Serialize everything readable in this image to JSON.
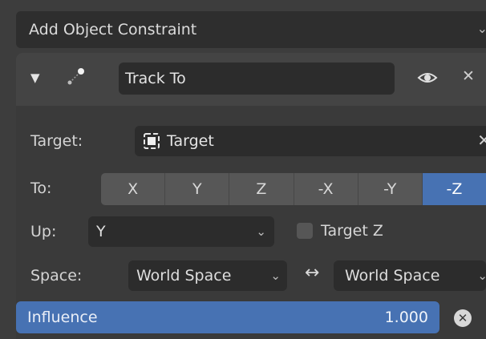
{
  "add_constraint": {
    "label": "Add Object Constraint",
    "chevron": "⌄"
  },
  "constraint": {
    "collapse_icon": "▼",
    "icon_name": "track-to-constraint-icon",
    "name": "Track To",
    "close": "✕"
  },
  "target": {
    "label": "Target:",
    "value": "Target",
    "clear": "✕"
  },
  "to": {
    "label": "To:",
    "axes": [
      "X",
      "Y",
      "Z",
      "-X",
      "-Y",
      "-Z"
    ],
    "active": "-Z"
  },
  "up": {
    "label": "Up:",
    "value": "Y",
    "target_z_label": "Target Z",
    "target_z_checked": false
  },
  "space": {
    "label": "Space:",
    "owner": "World Space",
    "target": "World Space",
    "swap": "↔"
  },
  "influence": {
    "label": "Influence",
    "value": "1.000",
    "clear": "✕"
  },
  "colors": {
    "accent": "#4772b3",
    "panel": "#3a3a3a",
    "field": "#2c2c2c"
  }
}
